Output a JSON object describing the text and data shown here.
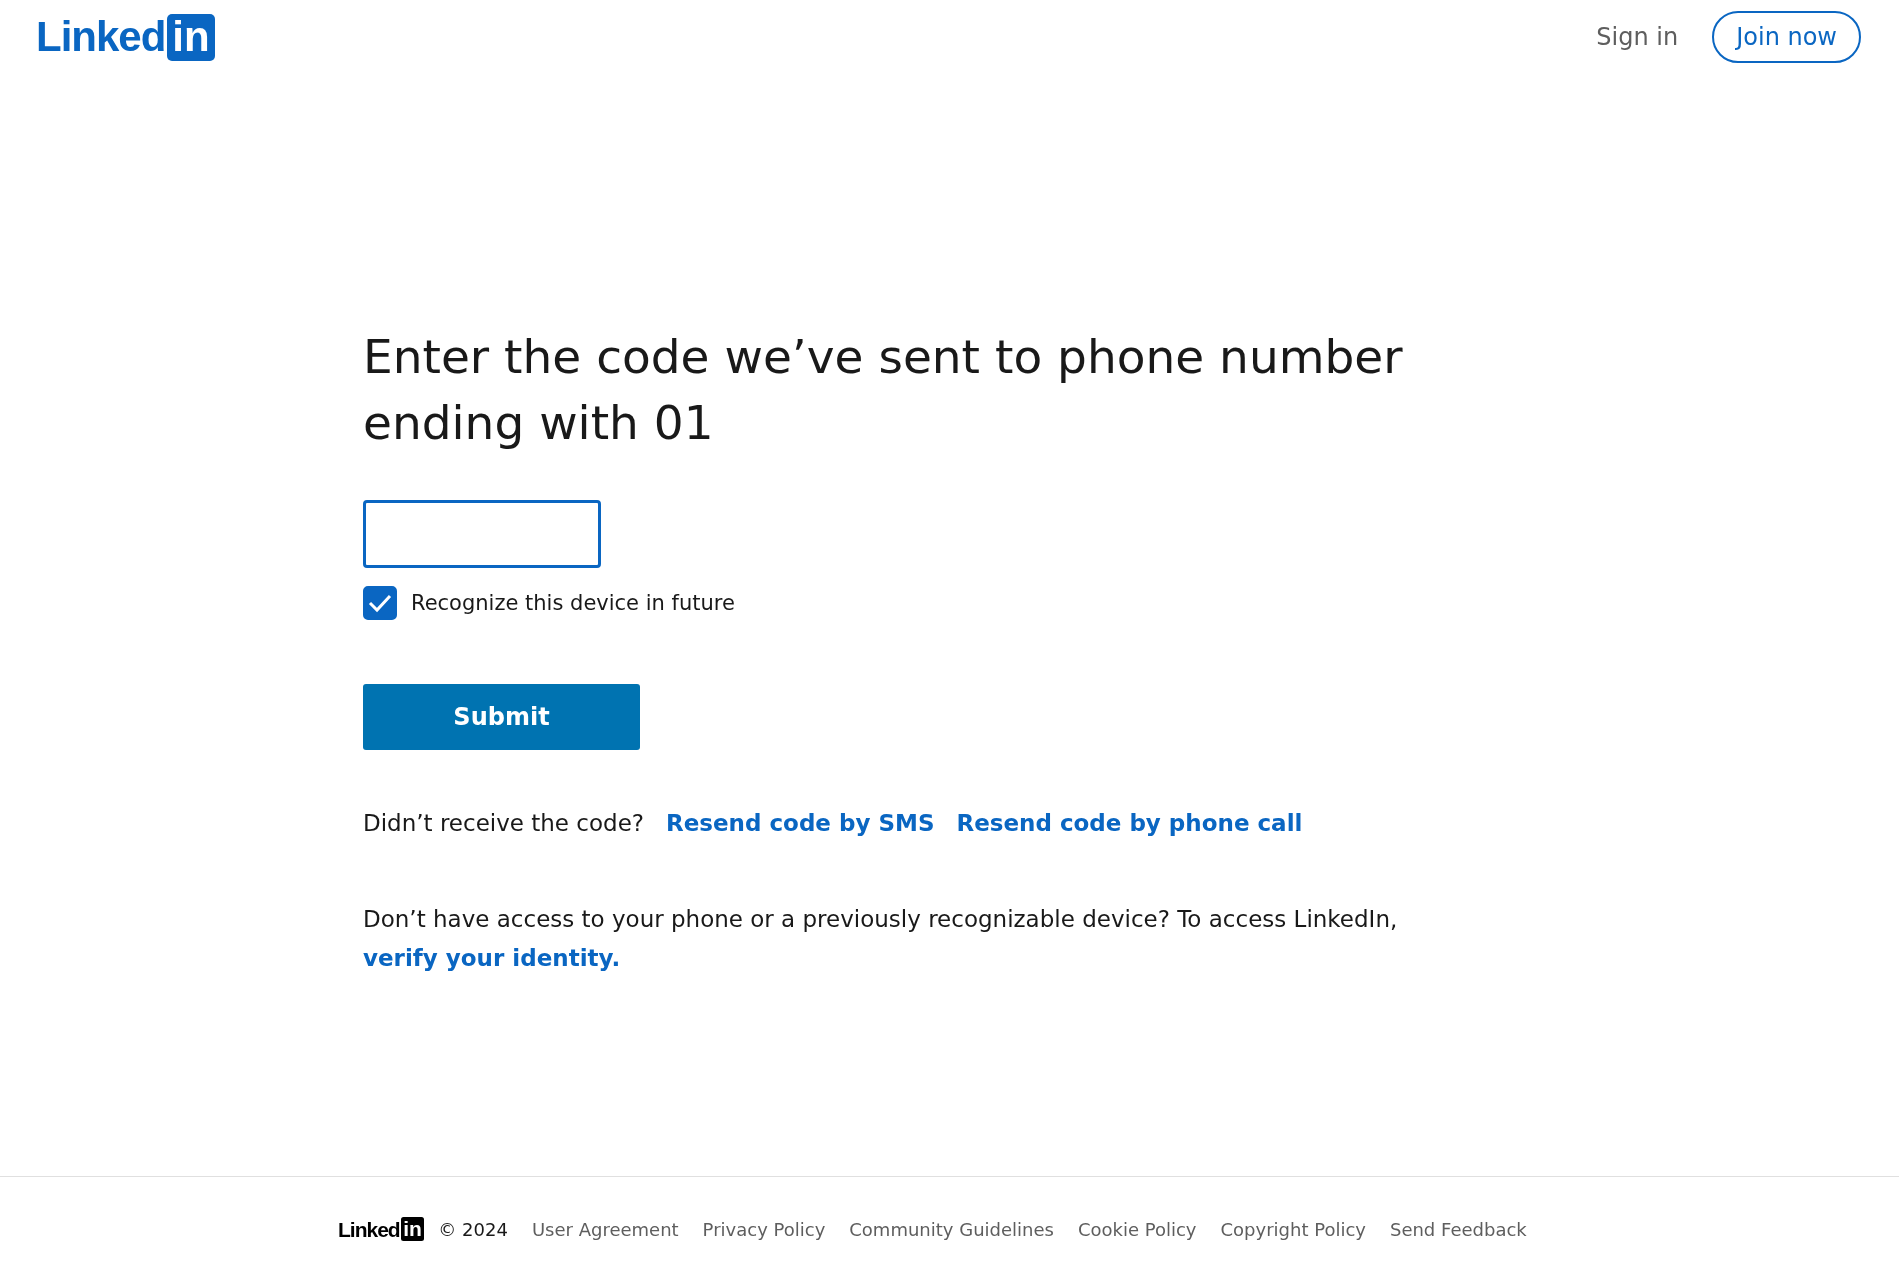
{
  "header": {
    "logo": {
      "word": "Linked",
      "badge": "in"
    },
    "sign_in": "Sign in",
    "join_now": "Join now"
  },
  "heading": "Enter the code we’ve sent to phone number ending with 01",
  "code_field": {
    "focused": true
  },
  "remember": {
    "label": "Recognize this device in future",
    "checked": true
  },
  "submit": "Submit",
  "resend": {
    "prompt": "Didn’t receive the code?",
    "links": [
      "Resend code by SMS",
      "Resend code by phone call"
    ]
  },
  "access_note": {
    "text": "Don’t have access to your phone or a previously recognizable device? To access LinkedIn,",
    "link": "verify your identity."
  },
  "footer": {
    "logo": {
      "word": "Linked",
      "badge": "in"
    },
    "copyright": "© 2024",
    "links": [
      "User Agreement",
      "Privacy Policy",
      "Community Guidelines",
      "Cookie Policy",
      "Copyright Policy",
      "Send Feedback"
    ]
  }
}
